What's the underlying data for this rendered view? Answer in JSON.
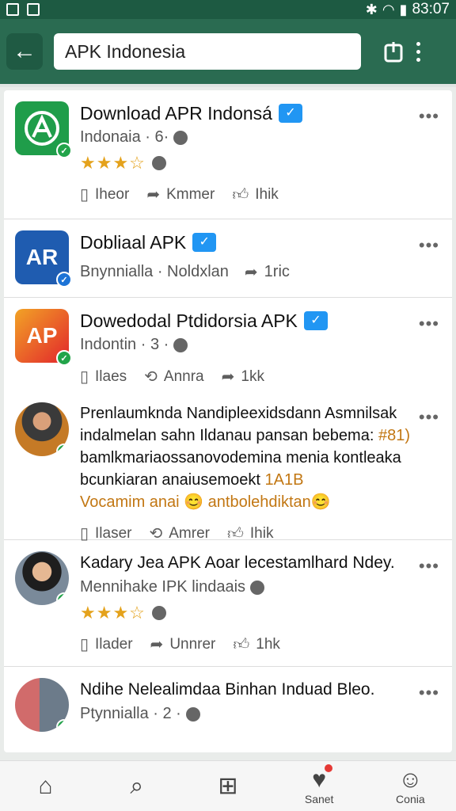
{
  "status": {
    "time": "83:07"
  },
  "search": {
    "value": "APK Indonesia"
  },
  "posts": [
    {
      "title": "Download APR Indonsá",
      "meta": "Indonaia · 6·",
      "rating": 3.5,
      "actions": [
        "Iheor",
        "Kmmer",
        "Ihik"
      ],
      "avatar_text": "A",
      "avatar_color": "#1f9d4a"
    },
    {
      "title": "Dobliaal APK",
      "meta": "Bnynnialla · Noldxlan",
      "rating_action": "1ric",
      "avatar_text": "AR",
      "avatar_color": "#1f5cb0"
    },
    {
      "title": "Dowedodal Ptdidorsia APK",
      "meta": "Indontin · 3 ·",
      "actions": [
        "Ilaes",
        "Annra",
        "1kk"
      ],
      "avatar_text": "AP",
      "avatar_color": "#e53f2c"
    },
    {
      "line1": "Prenlaumknda Nandipleexidsdann Asmnilsak",
      "line2": "indalmelan sahn Ildanau pansan bebema:",
      "line2_orange": "#81)",
      "line3": "bamlkmariaossanovodemina menia kontleaka",
      "line4": "bcunkiaran anaiusemoekt",
      "line4_orange": "1A1B",
      "line5": "Vocamim anai",
      "line5_tail": "antbolehdiktan",
      "actions": [
        "Ilaser",
        "Amrer",
        "Ihik"
      ]
    },
    {
      "title": "Kadary Jea APK Aoar lecestamlhard Ndey.",
      "meta": "Mennihake IPK lindaais",
      "rating": 3.5,
      "actions": [
        "Ilader",
        "Unnrer",
        "1hk"
      ]
    },
    {
      "title": "Ndihe Nelealimdaa Binhan Induad Bleo.",
      "meta": "Ptynnialla · 2 ·"
    }
  ],
  "nav": [
    {
      "label": "",
      "icon": "home-icon"
    },
    {
      "label": "",
      "icon": "search-icon"
    },
    {
      "label": "",
      "icon": "add-icon"
    },
    {
      "label": "Sanet",
      "icon": "notifications-icon"
    },
    {
      "label": "Conia",
      "icon": "profile-icon"
    }
  ]
}
